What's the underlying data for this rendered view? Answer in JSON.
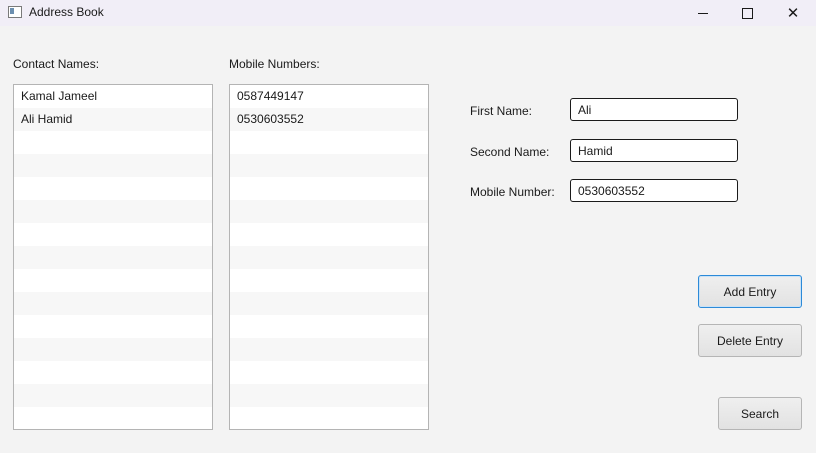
{
  "window": {
    "title": "Address Book",
    "minimize_icon": "minimize-icon",
    "maximize_icon": "maximize-icon",
    "close_icon": "close-icon"
  },
  "contacts": {
    "header": "Contact Names:",
    "items": [
      "Kamal Jameel",
      "Ali Hamid"
    ]
  },
  "mobiles": {
    "header": "Mobile Numbers:",
    "items": [
      "0587449147",
      "0530603552"
    ]
  },
  "form": {
    "first_name_label": "First Name:",
    "first_name_value": "Ali",
    "second_name_label": "Second Name:",
    "second_name_value": "Hamid",
    "mobile_label": "Mobile Number:",
    "mobile_value": "0530603552"
  },
  "actions": {
    "add": "Add Entry",
    "delete": "Delete Entry",
    "search": "Search"
  },
  "colors": {
    "titlebar": "#f1eef7",
    "window_bg": "#f3f3f3",
    "focus_border": "#2c8ad8"
  }
}
